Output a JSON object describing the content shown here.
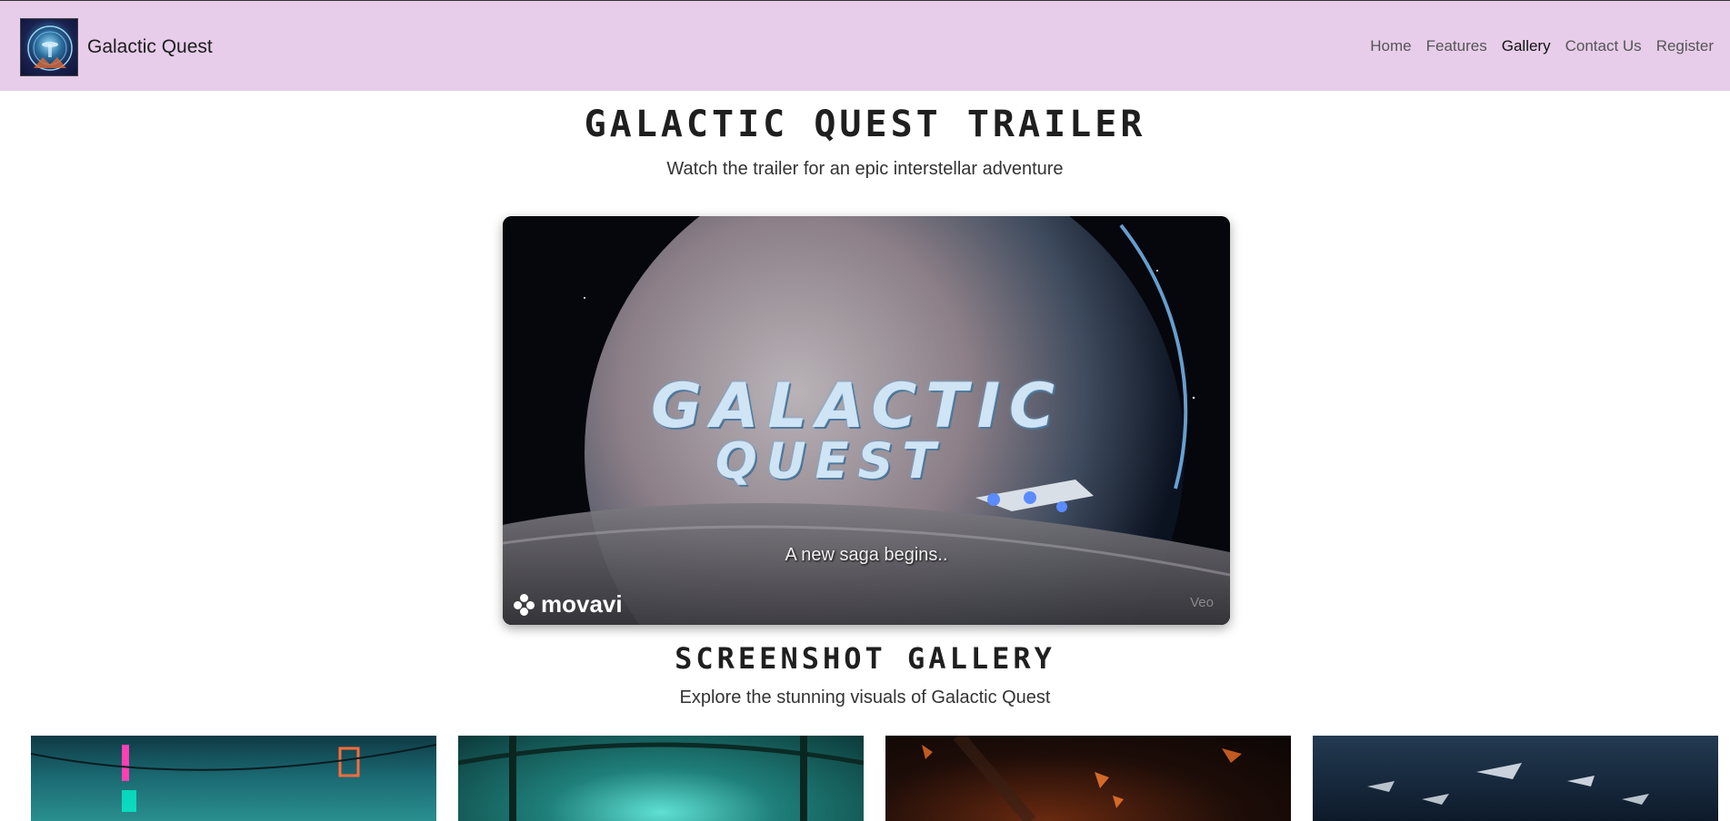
{
  "header": {
    "brand_name": "Galactic Quest",
    "nav": [
      "Home",
      "Features",
      "Gallery",
      "Contact Us",
      "Register"
    ],
    "active": "Gallery"
  },
  "trailer": {
    "title": "GALACTIC QUEST TRAILER",
    "subtitle": "Watch the trailer for an epic interstellar adventure",
    "video": {
      "logo_line1": "GALACTIC",
      "logo_line2": "QUEST",
      "caption": "A new saga begins..",
      "watermark": "movavi",
      "corner_text": "Veo"
    }
  },
  "gallery": {
    "title": "SCREENSHOT GALLERY",
    "subtitle": "Explore the stunning visuals of Galactic Quest"
  },
  "colors": {
    "navbar_bg": "#e7cdea",
    "text_dark": "#1c1c1c"
  }
}
